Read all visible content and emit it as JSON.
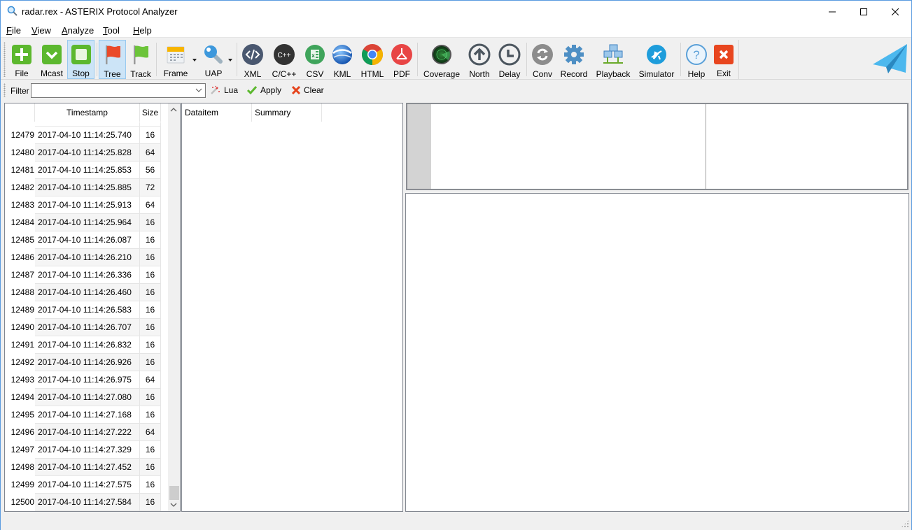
{
  "window": {
    "title": "radar.rex - ASTERIX Protocol Analyzer",
    "controls": {
      "minimize": "minimize",
      "maximize": "maximize",
      "close": "close"
    }
  },
  "menu": [
    {
      "label": "File",
      "accel": "F"
    },
    {
      "label": "View",
      "accel": "V"
    },
    {
      "label": "Analyze",
      "accel": "A"
    },
    {
      "label": "Tool",
      "accel": "T"
    },
    {
      "label": "Help",
      "accel": "H"
    }
  ],
  "toolbar": {
    "buttons": [
      {
        "id": "file",
        "label": "File",
        "icon": "plus-icon"
      },
      {
        "id": "mcast",
        "label": "Mcast",
        "icon": "checkmark-icon"
      },
      {
        "id": "stop",
        "label": "Stop",
        "icon": "stop-icon",
        "state": "pressed"
      },
      {
        "id": "tree",
        "label": "Tree",
        "icon": "red-flag-icon",
        "state": "active"
      },
      {
        "id": "track",
        "label": "Track",
        "icon": "green-flag-icon"
      },
      {
        "id": "frame",
        "label": "Frame",
        "icon": "calendar-icon",
        "dropdown": true
      },
      {
        "id": "uap",
        "label": "UAP",
        "icon": "key-icon",
        "dropdown": true
      },
      {
        "id": "xml",
        "label": "XML",
        "icon": "code-icon"
      },
      {
        "id": "cpp",
        "label": "C/C++",
        "icon": "cpp-icon"
      },
      {
        "id": "csv",
        "label": "CSV",
        "icon": "excel-icon"
      },
      {
        "id": "kml",
        "label": "KML",
        "icon": "globe-icon"
      },
      {
        "id": "html",
        "label": "HTML",
        "icon": "chrome-icon"
      },
      {
        "id": "pdf",
        "label": "PDF",
        "icon": "pdf-icon"
      },
      {
        "id": "coverage",
        "label": "Coverage",
        "icon": "radar-icon"
      },
      {
        "id": "north",
        "label": "North",
        "icon": "arrow-up-icon"
      },
      {
        "id": "delay",
        "label": "Delay",
        "icon": "clock-icon"
      },
      {
        "id": "conv",
        "label": "Conv",
        "icon": "convert-icon"
      },
      {
        "id": "record",
        "label": "Record",
        "icon": "gear-icon"
      },
      {
        "id": "playback",
        "label": "Playback",
        "icon": "network-icon"
      },
      {
        "id": "simulator",
        "label": "Simulator",
        "icon": "airplane-icon"
      },
      {
        "id": "help",
        "label": "Help",
        "icon": "question-icon"
      },
      {
        "id": "exit",
        "label": "Exit",
        "icon": "close-icon"
      }
    ],
    "logo": "paper-plane-logo"
  },
  "filter": {
    "label": "Filter",
    "value": "",
    "lua_label": "Lua",
    "apply_label": "Apply",
    "clear_label": "Clear"
  },
  "packets": {
    "columns": [
      "",
      "Timestamp",
      "Size"
    ],
    "rows": [
      {
        "num": "12479",
        "timestamp": "2017-04-10 11:14:25.740",
        "size": "16"
      },
      {
        "num": "12480",
        "timestamp": "2017-04-10 11:14:25.828",
        "size": "64"
      },
      {
        "num": "12481",
        "timestamp": "2017-04-10 11:14:25.853",
        "size": "56"
      },
      {
        "num": "12482",
        "timestamp": "2017-04-10 11:14:25.885",
        "size": "72"
      },
      {
        "num": "12483",
        "timestamp": "2017-04-10 11:14:25.913",
        "size": "64"
      },
      {
        "num": "12484",
        "timestamp": "2017-04-10 11:14:25.964",
        "size": "16"
      },
      {
        "num": "12485",
        "timestamp": "2017-04-10 11:14:26.087",
        "size": "16"
      },
      {
        "num": "12486",
        "timestamp": "2017-04-10 11:14:26.210",
        "size": "16"
      },
      {
        "num": "12487",
        "timestamp": "2017-04-10 11:14:26.336",
        "size": "16"
      },
      {
        "num": "12488",
        "timestamp": "2017-04-10 11:14:26.460",
        "size": "16"
      },
      {
        "num": "12489",
        "timestamp": "2017-04-10 11:14:26.583",
        "size": "16"
      },
      {
        "num": "12490",
        "timestamp": "2017-04-10 11:14:26.707",
        "size": "16"
      },
      {
        "num": "12491",
        "timestamp": "2017-04-10 11:14:26.832",
        "size": "16"
      },
      {
        "num": "12492",
        "timestamp": "2017-04-10 11:14:26.926",
        "size": "16"
      },
      {
        "num": "12493",
        "timestamp": "2017-04-10 11:14:26.975",
        "size": "64"
      },
      {
        "num": "12494",
        "timestamp": "2017-04-10 11:14:27.080",
        "size": "16"
      },
      {
        "num": "12495",
        "timestamp": "2017-04-10 11:14:27.168",
        "size": "16"
      },
      {
        "num": "12496",
        "timestamp": "2017-04-10 11:14:27.222",
        "size": "64"
      },
      {
        "num": "12497",
        "timestamp": "2017-04-10 11:14:27.329",
        "size": "16"
      },
      {
        "num": "12498",
        "timestamp": "2017-04-10 11:14:27.452",
        "size": "16"
      },
      {
        "num": "12499",
        "timestamp": "2017-04-10 11:14:27.575",
        "size": "16"
      },
      {
        "num": "12500",
        "timestamp": "2017-04-10 11:14:27.584",
        "size": "16"
      }
    ],
    "scroll_position": 1.0
  },
  "details": {
    "columns": [
      "Dataitem",
      "Summary"
    ]
  }
}
